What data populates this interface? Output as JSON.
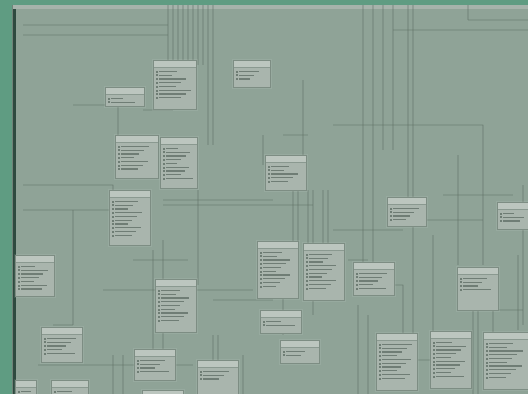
{
  "window": {
    "title": ""
  },
  "diagram": {
    "tables": [
      {
        "id": "t1",
        "rows": 2
      },
      {
        "id": "t2",
        "rows": 9
      },
      {
        "id": "t3",
        "rows": 5
      },
      {
        "id": "t4",
        "rows": 9
      },
      {
        "id": "t5",
        "rows": 9
      },
      {
        "id": "t6",
        "rows": 8
      },
      {
        "id": "t7",
        "rows": 13
      },
      {
        "id": "t8",
        "rows": 5
      },
      {
        "id": "t9",
        "rows": 3
      },
      {
        "id": "t10",
        "rows": 12
      },
      {
        "id": "t11",
        "rows": 12
      },
      {
        "id": "t12",
        "rows": 6
      },
      {
        "id": "t13",
        "rows": 9
      },
      {
        "id": "t14",
        "rows": 12
      },
      {
        "id": "t15",
        "rows": 4
      },
      {
        "id": "t16",
        "rows": 7
      },
      {
        "id": "t17",
        "rows": 3
      },
      {
        "id": "t18",
        "rows": 6
      },
      {
        "id": "t19",
        "rows": 10
      },
      {
        "id": "t20",
        "rows": 13
      },
      {
        "id": "t21",
        "rows": 12
      },
      {
        "id": "t22",
        "rows": 12
      },
      {
        "id": "t23",
        "rows": 3
      },
      {
        "id": "t24",
        "rows": 4
      },
      {
        "id": "t25",
        "rows": 3
      },
      {
        "id": "t26",
        "rows": 4
      }
    ]
  }
}
